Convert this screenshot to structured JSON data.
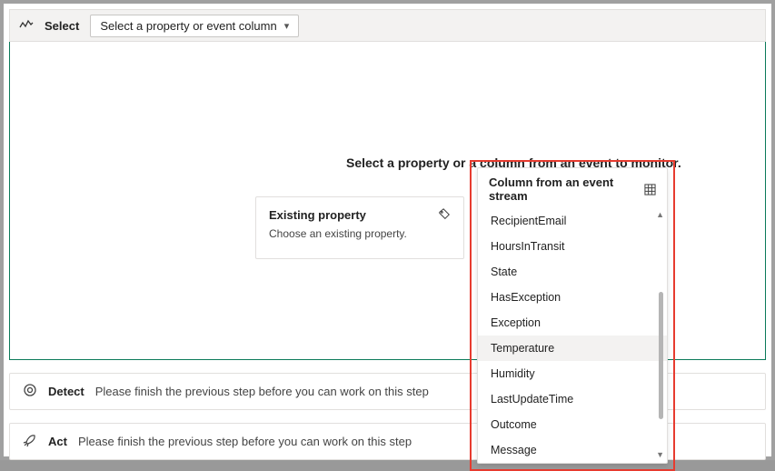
{
  "toolbar": {
    "step_label": "Select",
    "dropdown_placeholder": "Select a property or event column"
  },
  "main": {
    "prompt": "Select a property or a column from an event to monitor.",
    "existing_card": {
      "title": "Existing property",
      "subtitle": "Choose an existing property."
    },
    "event_column_panel": {
      "title": "Column from an event stream",
      "highlighted": "Temperature",
      "items": [
        "RecipientEmail",
        "HoursInTransit",
        "State",
        "HasException",
        "Exception",
        "Temperature",
        "Humidity",
        "LastUpdateTime",
        "Outcome",
        "Message"
      ]
    }
  },
  "steps": {
    "detect": {
      "title": "Detect",
      "message": "Please finish the previous step before you can work on this step"
    },
    "act": {
      "title": "Act",
      "message": "Please finish the previous step before you can work on this step"
    }
  }
}
